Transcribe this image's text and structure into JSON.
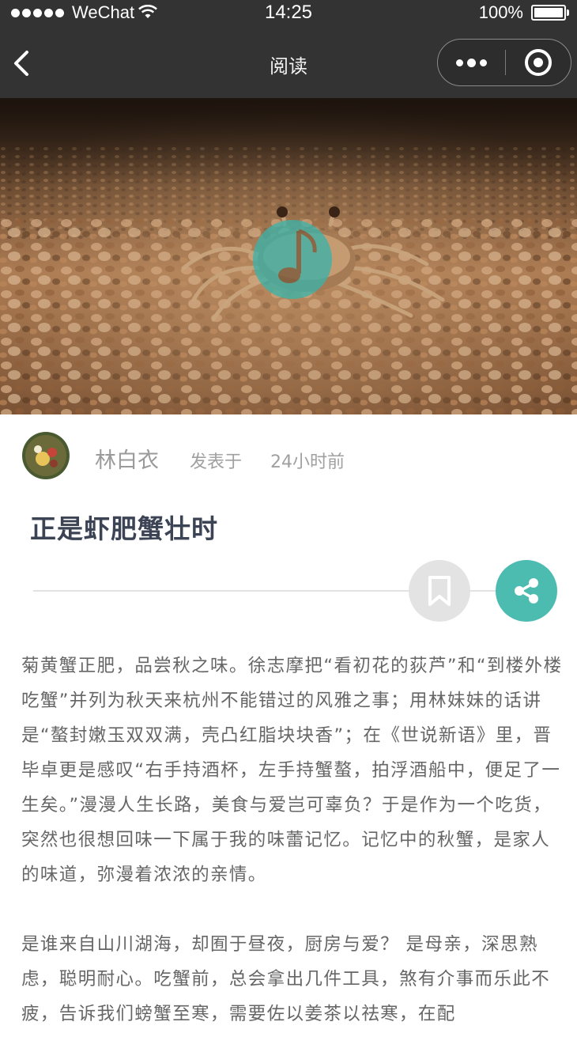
{
  "status_bar": {
    "carrier": "WeChat",
    "time": "14:25",
    "battery": "100%"
  },
  "nav": {
    "title": "阅读"
  },
  "author": {
    "name": "林白衣",
    "posted_label": "发表于",
    "posted_time": "24小时前"
  },
  "article": {
    "title": "正是虾肥蟹壮时",
    "paragraphs": [
      "菊黄蟹正肥，品尝秋之味。徐志摩把“看初花的荻芦”和“到楼外楼吃蟹”并列为秋天来杭州不能错过的风雅之事；用林妹妹的话讲是“螯封嫩玉双双满，壳凸红脂块块香”；在《世说新语》里，晋毕卓更是感叹“右手持酒杯，左手持蟹螯，拍浮酒船中，便足了一生矣。”漫漫人生长路，美食与爱岂可辜负？于是作为一个吃货，突然也很想回味一下属于我的味蕾记忆。记忆中的秋蟹，是家人的味道，弥漫着浓浓的亲情。",
      "是谁来自山川湖海，却囿于昼夜，厨房与爱？ 是母亲，深思熟虑，聪明耐心。吃蟹前，总会拿出几件工具，煞有介事而乐此不疲，告诉我们螃蟹至寒，需要佐以姜茶以祛寒，在配"
    ]
  },
  "colors": {
    "bar_bg": "#333333",
    "accent_teal": "#4cbcb0",
    "title_color": "#3b4354",
    "body_text": "#666666"
  },
  "icons": {
    "back": "chevron-left-icon",
    "more": "more-dots-icon",
    "close": "target-circle-icon",
    "bookmark": "bookmark-icon",
    "share": "share-icon",
    "watermark": "music-note-logo"
  }
}
